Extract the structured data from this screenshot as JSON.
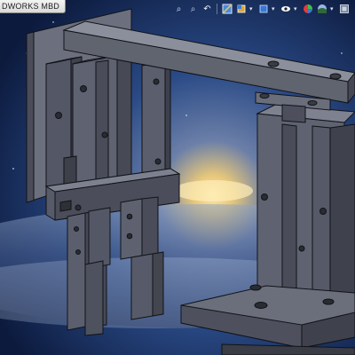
{
  "app": {
    "tab_label": "DWORKS MBD"
  },
  "toolbar": {
    "items": [
      {
        "name": "zoom-to-fit-icon",
        "glyph": "🔍"
      },
      {
        "name": "zoom-to-area-icon",
        "glyph": "🔎"
      },
      {
        "name": "previous-view-icon",
        "glyph": "↶"
      },
      {
        "name": "section-view-icon",
        "glyph": "▥"
      },
      {
        "name": "view-orientation-icon",
        "glyph": "◩"
      },
      {
        "name": "display-style-icon",
        "glyph": "◼"
      },
      {
        "name": "hide-show-items-icon",
        "glyph": "👁"
      },
      {
        "name": "edit-appearance-icon",
        "glyph": "●"
      },
      {
        "name": "apply-scene-icon",
        "glyph": "◐"
      },
      {
        "name": "view-settings-icon",
        "glyph": "▣"
      }
    ]
  },
  "colors": {
    "part_face": "#5d6170",
    "part_dark": "#3e414c",
    "part_light": "#7a7e8c",
    "edge": "#111318",
    "sky_top": "#1c3d78",
    "sky_glow": "#f3d58e"
  }
}
